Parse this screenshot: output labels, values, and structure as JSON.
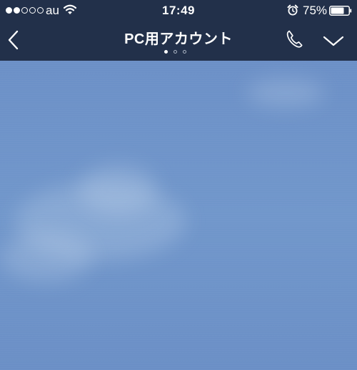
{
  "status_bar": {
    "carrier": "au",
    "time": "17:49",
    "battery_percent": "75%",
    "battery_level": 0.75,
    "signal_bars_filled": 2,
    "signal_bars_total": 5
  },
  "header": {
    "title": "PC用アカウント",
    "page_indicator": {
      "count": 3,
      "active_index": 0
    }
  },
  "icons": {
    "back": "chevron-left-icon",
    "call": "phone-icon",
    "menu": "chevron-down-icon",
    "wifi": "wifi-icon",
    "alarm": "alarm-clock-icon",
    "battery": "battery-icon"
  },
  "colors": {
    "header_background": "#22304a",
    "chat_background": "#6f93c9",
    "foreground": "#ffffff"
  }
}
